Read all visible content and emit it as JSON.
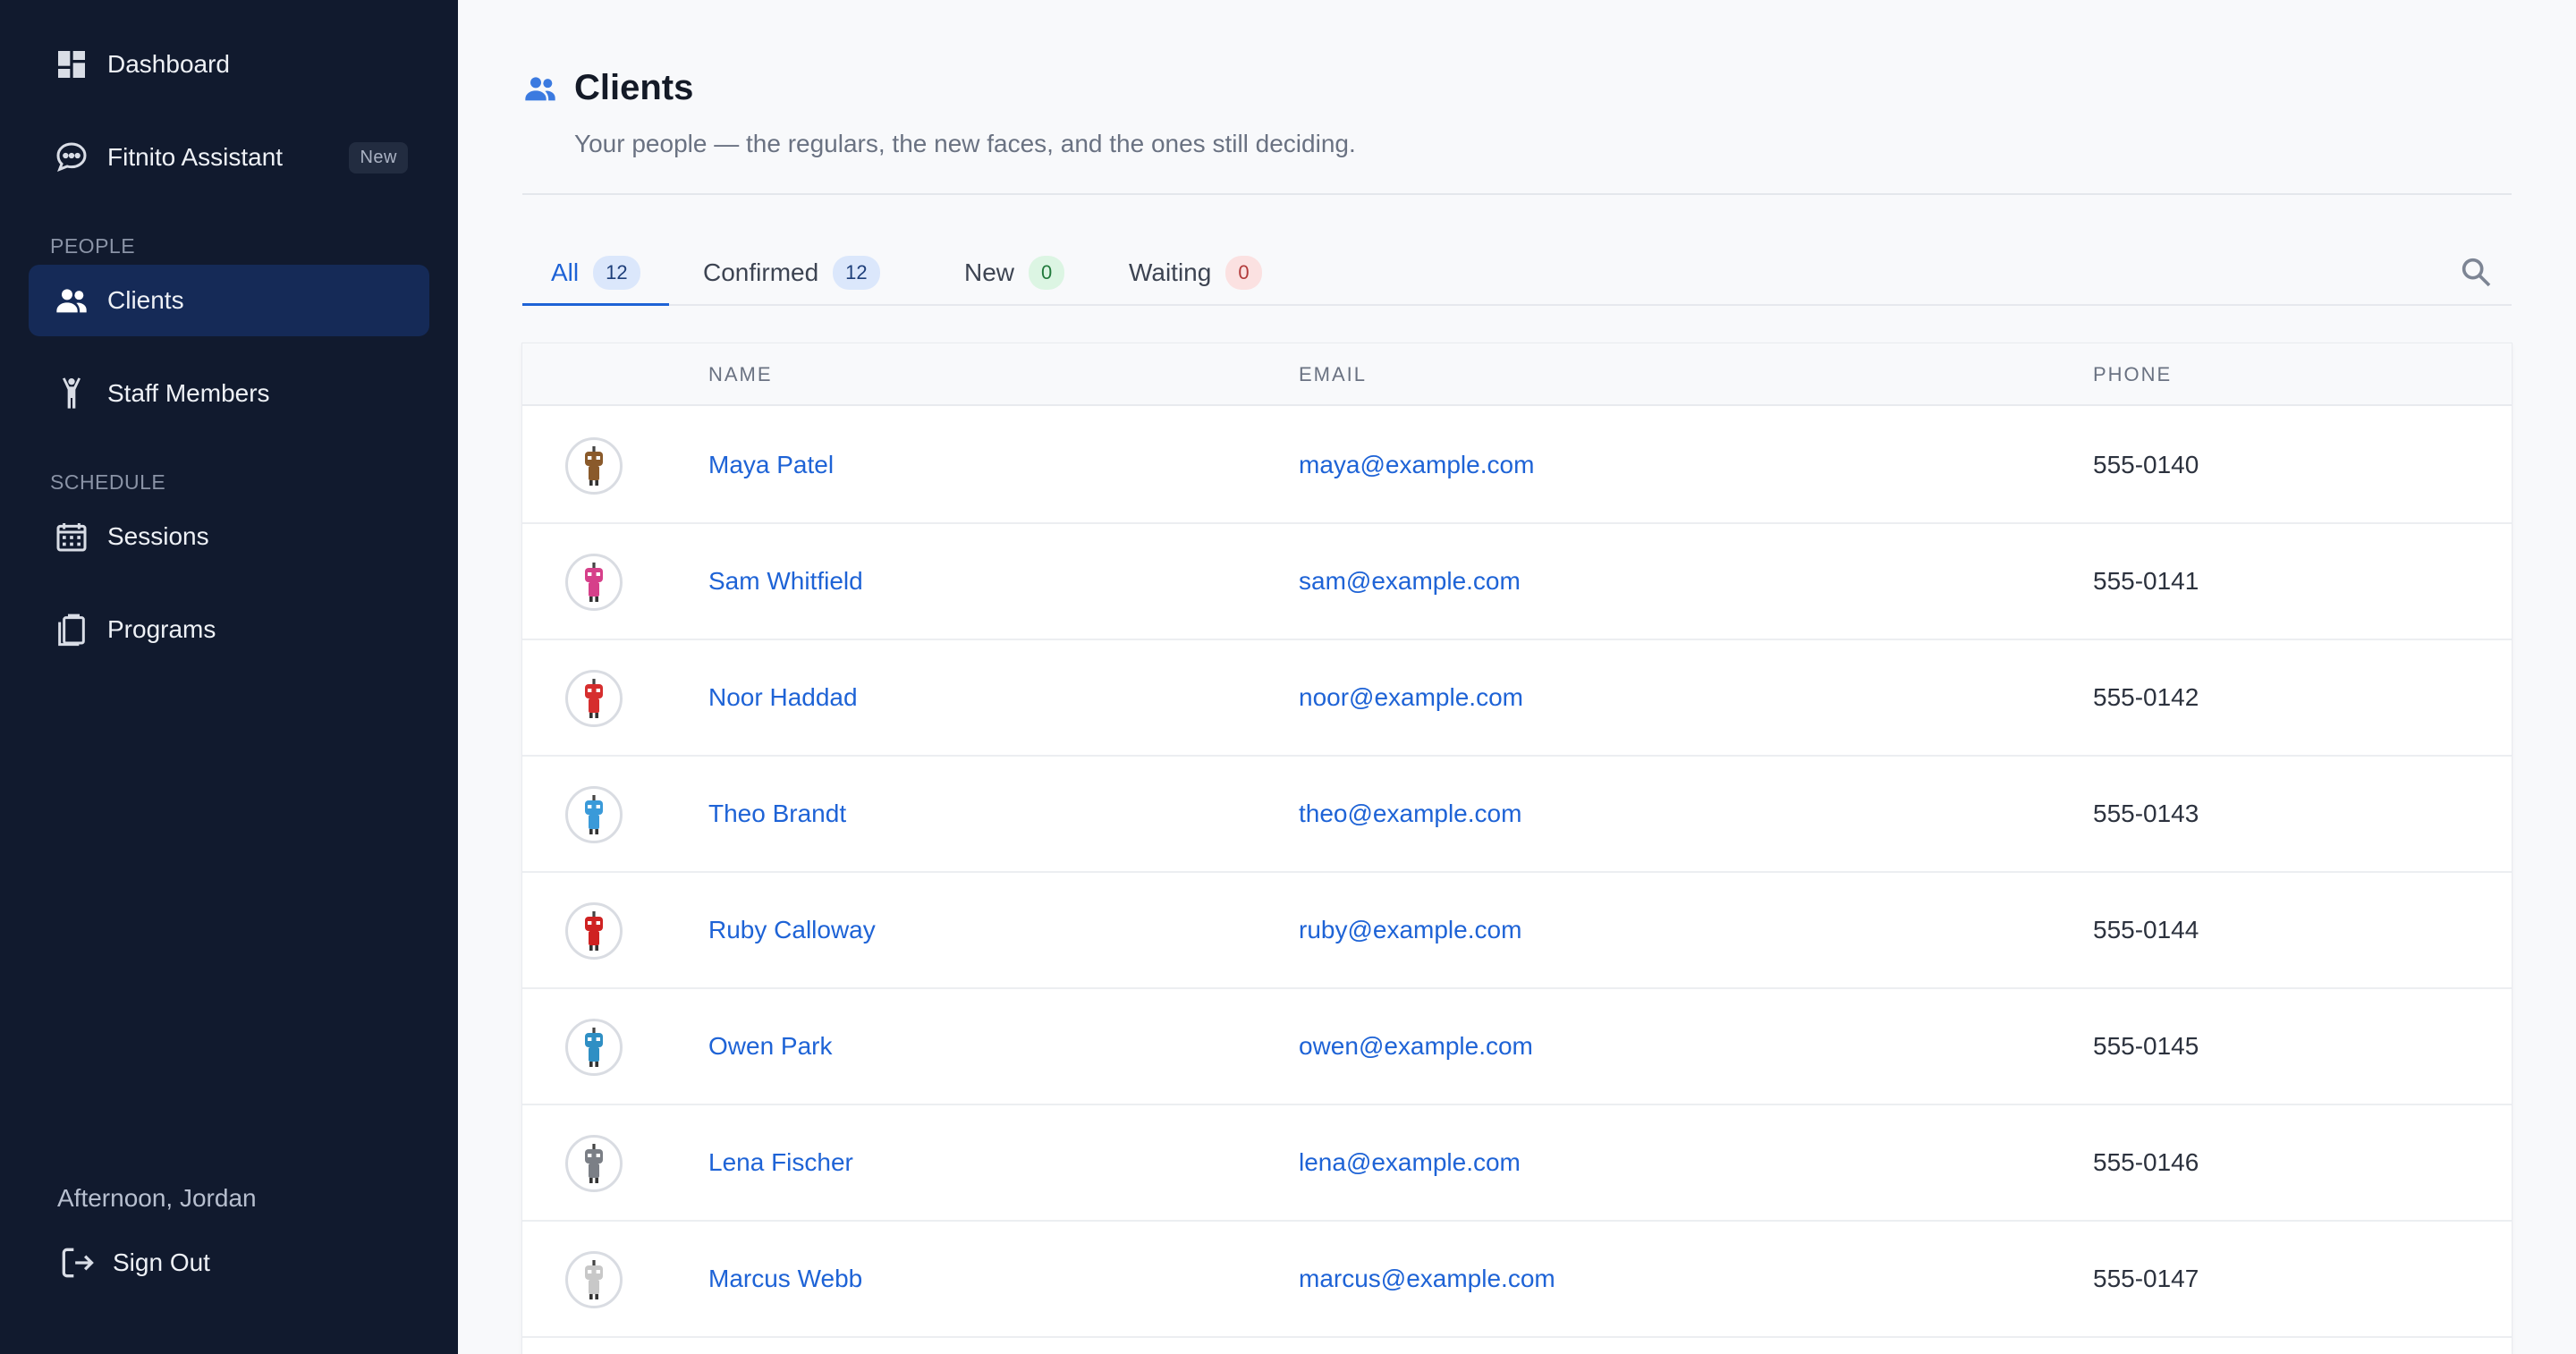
{
  "sidebar": {
    "nav": [
      {
        "label": "Dashboard"
      },
      {
        "label": "Fitnito Assistant",
        "badge": "New"
      }
    ],
    "sections": [
      {
        "label": "PEOPLE",
        "items": [
          {
            "label": "Clients"
          },
          {
            "label": "Staff Members"
          }
        ]
      },
      {
        "label": "SCHEDULE",
        "items": [
          {
            "label": "Sessions"
          },
          {
            "label": "Programs"
          }
        ]
      }
    ],
    "greeting": "Afternoon, Jordan",
    "signout_label": "Sign Out"
  },
  "page": {
    "title": "Clients",
    "subtitle": "Your people — the regulars, the new faces, and the ones still deciding."
  },
  "tabs": [
    {
      "label": "All",
      "count": "12"
    },
    {
      "label": "Confirmed",
      "count": "12"
    },
    {
      "label": "New",
      "count": "0"
    },
    {
      "label": "Waiting",
      "count": "0"
    }
  ],
  "table": {
    "headers": {
      "name": "NAME",
      "email": "EMAIL",
      "phone": "PHONE"
    },
    "rows": [
      {
        "name": "Maya Patel",
        "email": "maya@example.com",
        "phone": "555-0140",
        "avatar_color": "#8a5a2b"
      },
      {
        "name": "Sam Whitfield",
        "email": "sam@example.com",
        "phone": "555-0141",
        "avatar_color": "#d6408a"
      },
      {
        "name": "Noor Haddad",
        "email": "noor@example.com",
        "phone": "555-0142",
        "avatar_color": "#d62e2e"
      },
      {
        "name": "Theo Brandt",
        "email": "theo@example.com",
        "phone": "555-0143",
        "avatar_color": "#3a9ad9"
      },
      {
        "name": "Ruby Calloway",
        "email": "ruby@example.com",
        "phone": "555-0144",
        "avatar_color": "#cf2222"
      },
      {
        "name": "Owen Park",
        "email": "owen@example.com",
        "phone": "555-0145",
        "avatar_color": "#2f8fc4"
      },
      {
        "name": "Lena Fischer",
        "email": "lena@example.com",
        "phone": "555-0146",
        "avatar_color": "#7b7f86"
      },
      {
        "name": "Marcus Webb",
        "email": "marcus@example.com",
        "phone": "555-0147",
        "avatar_color": "#c8c8c8"
      }
    ]
  },
  "colors": {
    "sidebar_bg": "#111a2e",
    "active_nav": "#152a57",
    "accent": "#1e63d6"
  }
}
